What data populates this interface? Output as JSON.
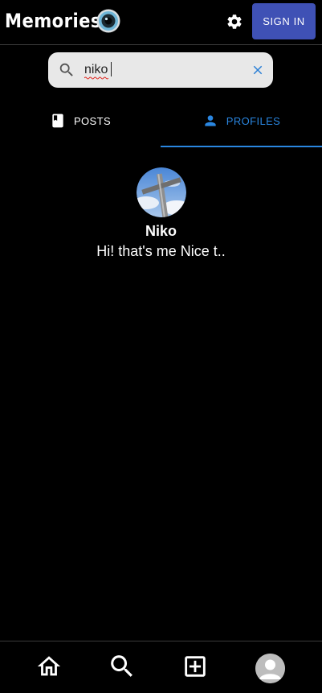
{
  "header": {
    "title": "Memories",
    "signin_label": "SIGN IN"
  },
  "search": {
    "value": "niko",
    "placeholder": ""
  },
  "tabs": [
    {
      "label": "POSTS",
      "icon": "book-icon",
      "active": false
    },
    {
      "label": "PROFILES",
      "icon": "person-icon",
      "active": true
    }
  ],
  "profile_result": {
    "name": "Niko",
    "bio": "Hi! that's me Nice t.."
  },
  "bottom_nav": {
    "items": [
      "home-icon",
      "search-icon",
      "add-box-icon",
      "account-avatar"
    ]
  },
  "colors": {
    "background": "#000000",
    "accent": "#2a86e0",
    "signin_button": "#3f51b5",
    "search_bg": "#e8e8e8"
  }
}
